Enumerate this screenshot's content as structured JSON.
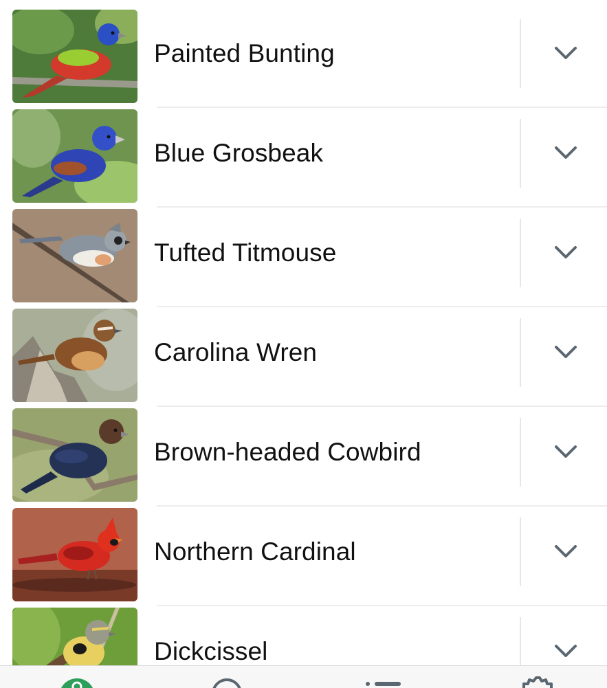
{
  "birds": [
    {
      "name": "Painted Bunting",
      "thumbnail": "painted-bunting-photo"
    },
    {
      "name": "Blue Grosbeak",
      "thumbnail": "blue-grosbeak-photo"
    },
    {
      "name": "Tufted Titmouse",
      "thumbnail": "tufted-titmouse-photo"
    },
    {
      "name": "Carolina Wren",
      "thumbnail": "carolina-wren-photo"
    },
    {
      "name": "Brown-headed Cowbird",
      "thumbnail": "brown-headed-cowbird-photo"
    },
    {
      "name": "Northern Cardinal",
      "thumbnail": "northern-cardinal-photo"
    },
    {
      "name": "Dickcissel",
      "thumbnail": "dickcissel-photo"
    }
  ],
  "row_action_icon": "chevron-down-icon",
  "tab_bar": {
    "tabs": [
      {
        "icon": "home-icon",
        "active": true
      },
      {
        "icon": "search-icon",
        "active": false
      },
      {
        "icon": "list-icon",
        "active": false
      },
      {
        "icon": "gear-icon",
        "active": false
      }
    ]
  },
  "colors": {
    "accent": "#2e9e5b",
    "text": "#111111",
    "chevron": "#5a6670",
    "separator": "#e6e6e6"
  }
}
